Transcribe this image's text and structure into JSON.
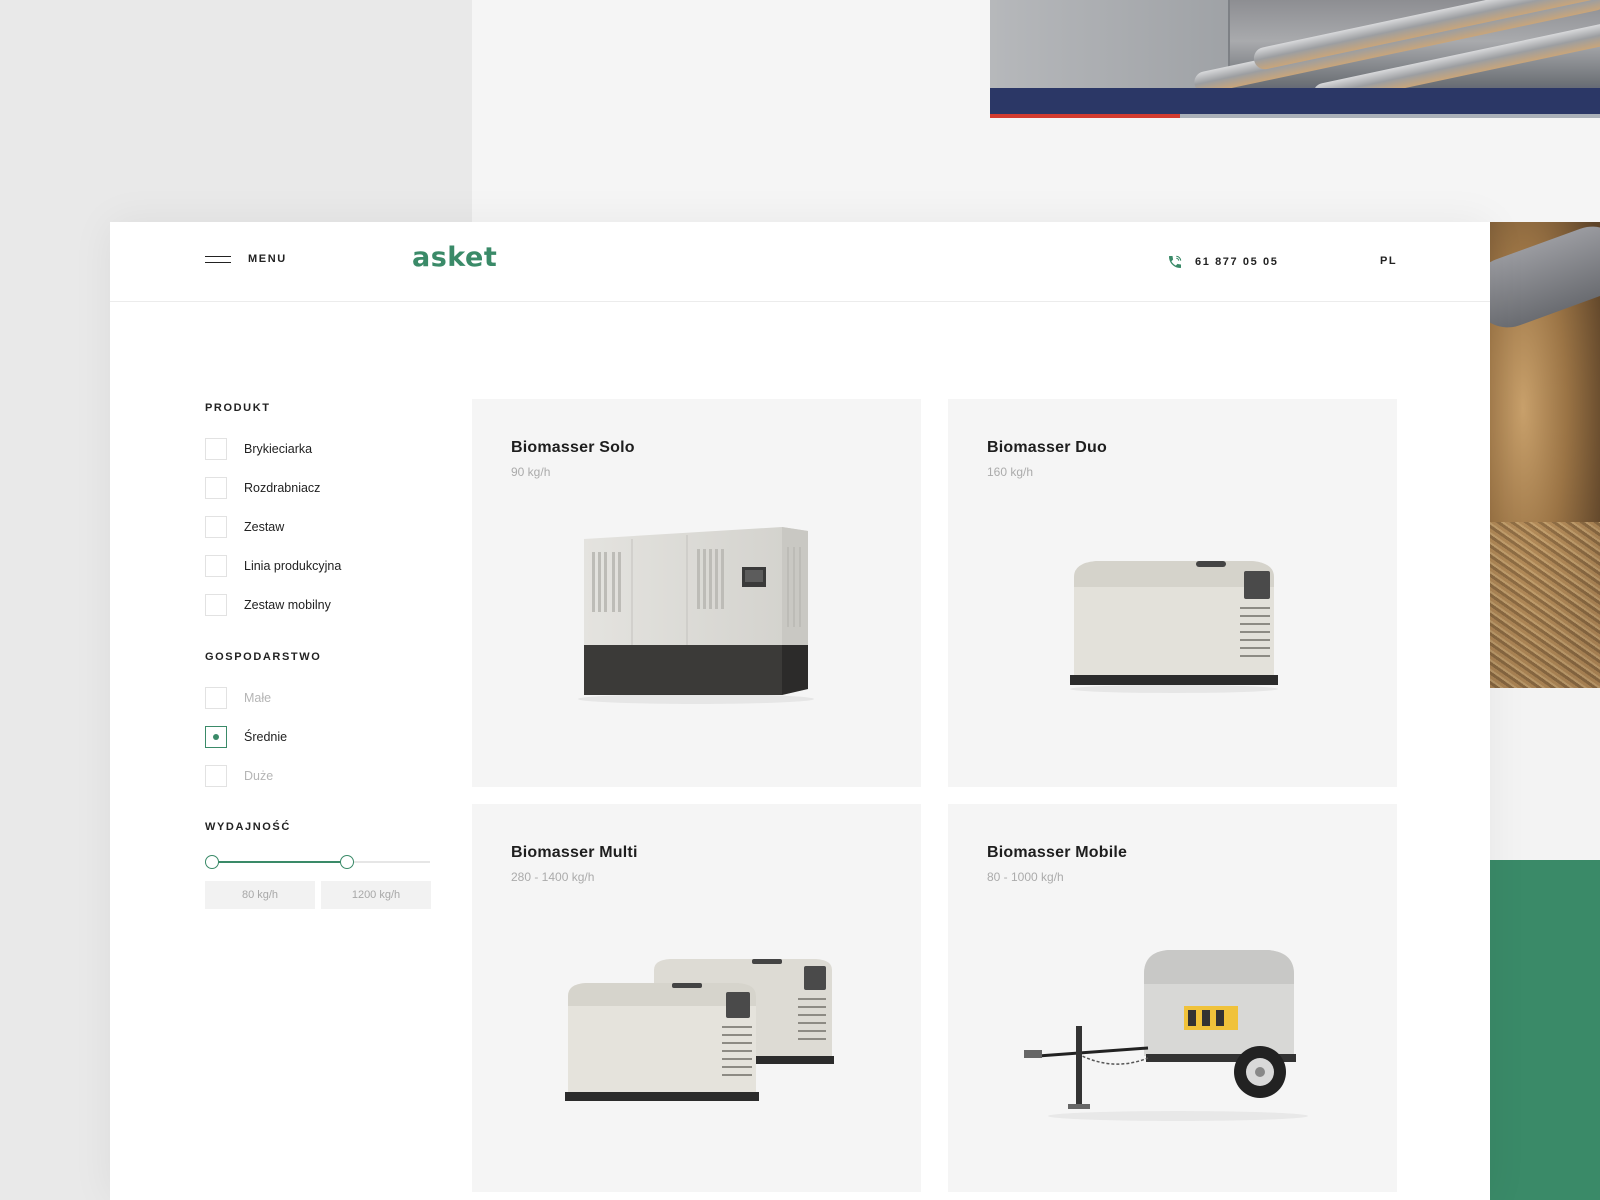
{
  "header": {
    "menu_label": "MENU",
    "logo": "asket",
    "phone": "61 877 05 05",
    "language": "PL"
  },
  "filters": {
    "product": {
      "heading": "PRODUKT",
      "options": [
        "Brykieciarka",
        "Rozdrabniacz",
        "Zestaw",
        "Linia produkcyjna",
        "Zestaw mobilny"
      ]
    },
    "farm": {
      "heading": "GOSPODARSTWO",
      "options": [
        "Małe",
        "Średnie",
        "Duże"
      ],
      "selected": "Średnie"
    },
    "capacity": {
      "heading": "WYDAJNOŚĆ",
      "min_value": "80 kg/h",
      "max_value": "1200 kg/h",
      "range_start_fraction": 0.0,
      "range_end_fraction": 0.64
    }
  },
  "products": [
    {
      "name": "Biomasser Solo",
      "capacity": "90 kg/h",
      "icon": "large-generator-icon"
    },
    {
      "name": "Biomasser Duo",
      "capacity": "160 kg/h",
      "icon": "generator-icon"
    },
    {
      "name": "Biomasser Multi",
      "capacity": "280 - 1400 kg/h",
      "icon": "twin-generator-icon"
    },
    {
      "name": "Biomasser Mobile",
      "capacity": "80 - 1000 kg/h",
      "icon": "trailer-generator-icon"
    }
  ],
  "colors": {
    "accent": "#3a8a68",
    "card_bg": "#f5f5f5",
    "text": "#222222",
    "muted": "#b5b5b5"
  }
}
